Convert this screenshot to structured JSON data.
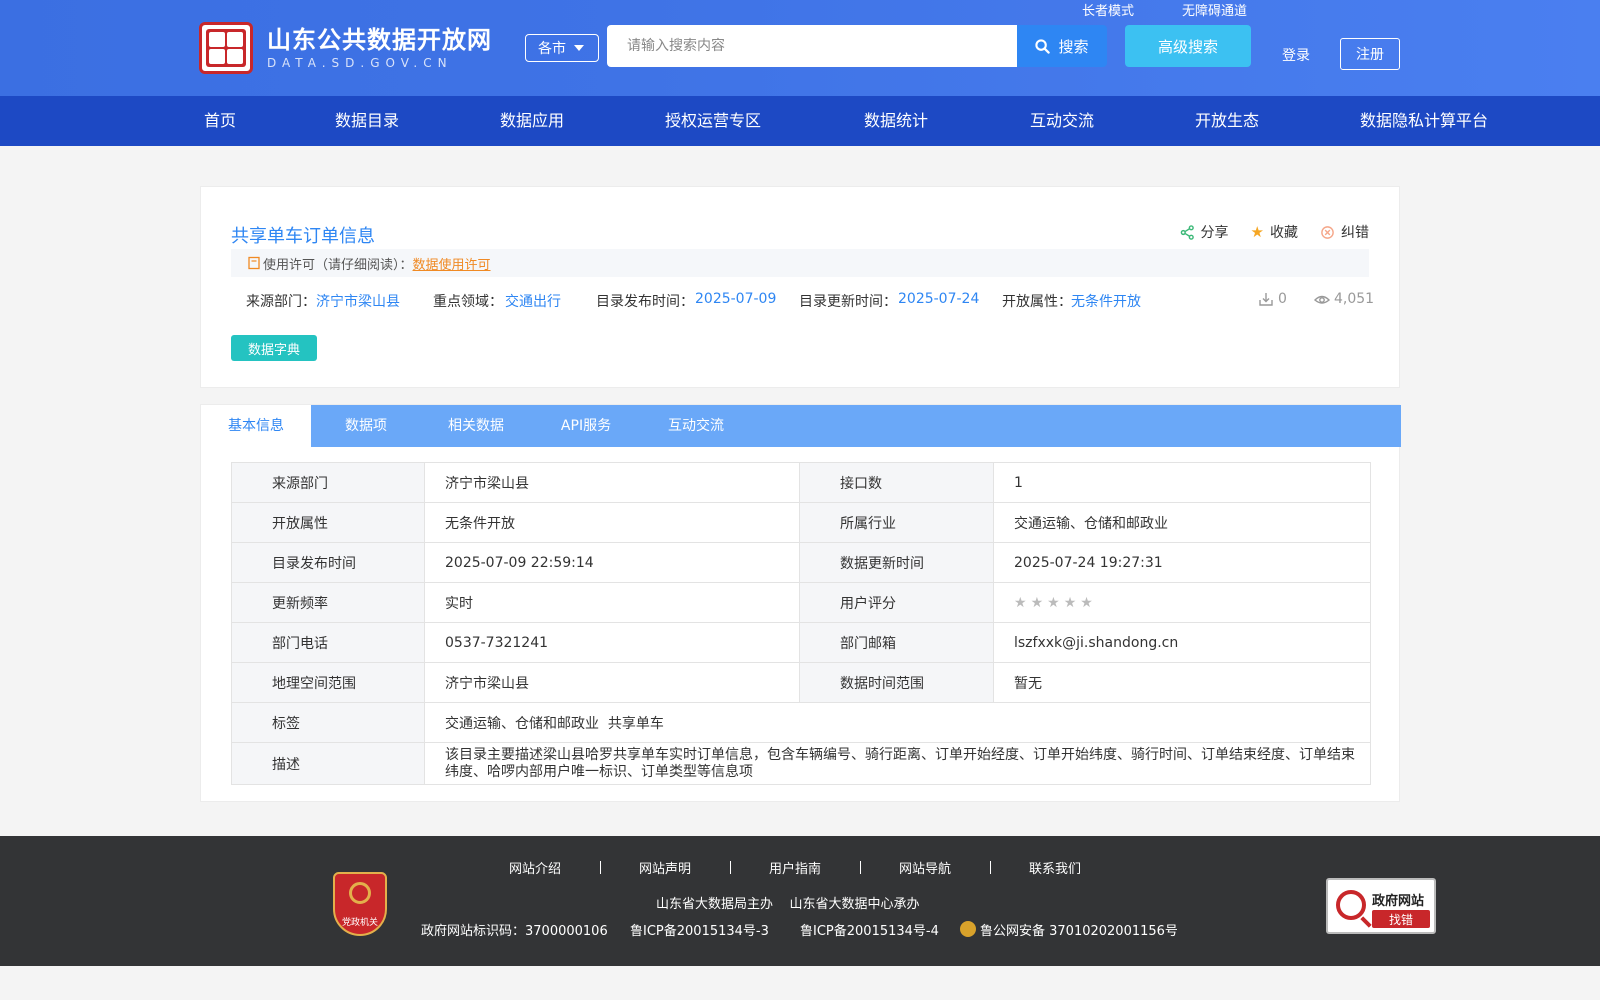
{
  "header": {
    "site_name_cn": "山东公共数据开放网",
    "site_name_en": "DATA.SD.GOV.CN",
    "elder_mode": "长者模式",
    "accessibility": "无障碍通道",
    "city_select": "各市",
    "search_placeholder": "请输入搜索内容",
    "search_button": "搜索",
    "advanced_search": "高级搜索",
    "login": "登录",
    "register": "注册"
  },
  "nav": [
    "首页",
    "数据目录",
    "数据应用",
    "授权运营专区",
    "数据统计",
    "互动交流",
    "开放生态",
    "数据隐私计算平台"
  ],
  "detail": {
    "title": "共享单车订单信息",
    "share": "分享",
    "favorite": "收藏",
    "report_error": "纠错",
    "license_prefix": "使用许可（请仔细阅读）：",
    "license_link": "数据使用许可",
    "source_dept_label": "来源部门：",
    "source_dept": "济宁市梁山县",
    "key_field_label": "重点领域：",
    "key_field": "交通出行",
    "publish_label": "目录发布时间：",
    "publish_date": "2025-07-09",
    "update_label": "目录更新时间：",
    "update_date": "2025-07-24",
    "open_attr_label": "开放属性：",
    "open_attr": "无条件开放",
    "download_count": "0",
    "view_count": "4,051",
    "dictionary_button": "数据字典"
  },
  "tabs": [
    "基本信息",
    "数据项",
    "相关数据",
    "API服务",
    "互动交流"
  ],
  "info_table": {
    "rows": [
      {
        "k1": "来源部门",
        "v1": "济宁市梁山县",
        "k2": "接口数",
        "v2": "1"
      },
      {
        "k1": "开放属性",
        "v1": "无条件开放",
        "k2": "所属行业",
        "v2": "交通运输、仓储和邮政业"
      },
      {
        "k1": "目录发布时间",
        "v1": "2025-07-09 22:59:14",
        "k2": "数据更新时间",
        "v2": "2025-07-24 19:27:31"
      },
      {
        "k1": "更新频率",
        "v1": "实时",
        "k2": "用户评分",
        "v2": ""
      },
      {
        "k1": "部门电话",
        "v1": "0537-7321241",
        "k2": "部门邮箱",
        "v2": "lszfxxk@ji.shandong.cn"
      },
      {
        "k1": "地理空间范围",
        "v1": "济宁市梁山县",
        "k2": "数据时间范围",
        "v2": "暂无"
      }
    ],
    "rating_stars": 0,
    "tags_label": "标签",
    "tags": "交通运输、仓储和邮政业  共享单车",
    "desc_label": "描述",
    "desc": "该目录主要描述梁山县哈罗共享单车实时订单信息，包含车辆编号、骑行距离、订单开始经度、订单开始纬度、骑行时间、订单结束经度、订单结束纬度、哈啰内部用户唯一标识、订单类型等信息项"
  },
  "footer": {
    "links": [
      "网站介绍",
      "网站声明",
      "用户指南",
      "网站导航",
      "联系我们"
    ],
    "host": "山东省大数据局主办    山东省大数据中心承办",
    "site_id": "政府网站标识码：3700000106",
    "icp1": "鲁ICP备20015134号-3",
    "icp2": "鲁ICP备20015134号-4",
    "police": "鲁公网安备 37010202001156号",
    "party_badge": "党政机关",
    "gov_badge_title": "政府网站",
    "gov_badge_action": "找错"
  },
  "colors": {
    "header_blue": "#3f73e6",
    "nav_blue": "#1d49c4",
    "link_blue": "#2e86f3",
    "tab_bar": "#6aa8f8",
    "dictionary_teal": "#24c3c1",
    "license_orange": "#f08a24",
    "footer_bg": "#333436"
  }
}
